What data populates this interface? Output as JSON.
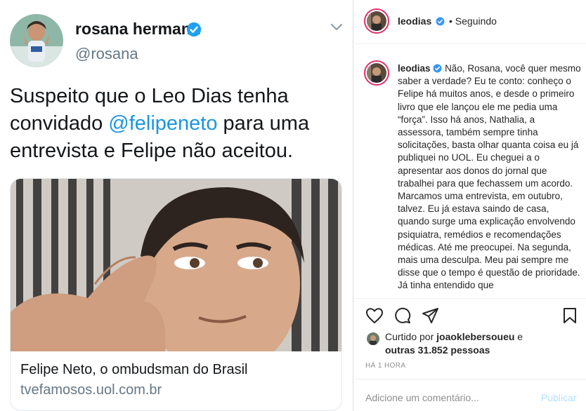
{
  "tweet": {
    "name": "rosana hermann",
    "handle": "@rosana",
    "text_before": "Suspeito que o Leo Dias tenha convidado ",
    "mention": "@felipeneto",
    "text_after": " para uma entrevista e Felipe não aceitou.",
    "card": {
      "title": "Felipe Neto, o ombudsman do Brasil",
      "domain": "tvefamosos.uol.com.br"
    }
  },
  "instagram": {
    "username": "leodias",
    "follow_status": "• Seguindo",
    "caption": "Não, Rosana, você quer mesmo saber a verdade? Eu te conto: conheço o Felipe há muitos anos, e desde o primeiro livro que ele lançou ele me pedia uma “força”. Isso há anos, Nathalia, a assessora, também sempre tinha solicitações, basta olhar quanta coisa eu já publiquei no UOL. Eu cheguei a o apresentar aos donos do jornal que trabalhei para que fechassem um acordo. Marcamos uma entrevista, em outubro, talvez. Eu já estava saindo de casa, quando surge uma explicação envolvendo psiquiatra, remédios e recomendações médicas. Até me preocupei. Na segunda, mais uma desculpa. Meu pai sempre me disse que o tempo é questão de prioridade. Já tinha entendido que",
    "liked_prefix": "Curtido por ",
    "liked_user": "joaoklebersoueu",
    "liked_mid": " e ",
    "liked_others": "outras 31.852 pessoas",
    "time_ago": "HÁ 1 HORA",
    "comment_placeholder": "Adicione um comentário...",
    "post_button": "Publicar"
  },
  "colors": {
    "twitter_blue": "#1b95e0",
    "ig_verified": "#3897f0",
    "ig_text": "#262626",
    "ig_muted": "#8e8e8e"
  },
  "icons": [
    "verified-badge-icon",
    "chevron-down-icon",
    "heart-icon",
    "comment-icon",
    "share-icon",
    "bookmark-icon"
  ]
}
